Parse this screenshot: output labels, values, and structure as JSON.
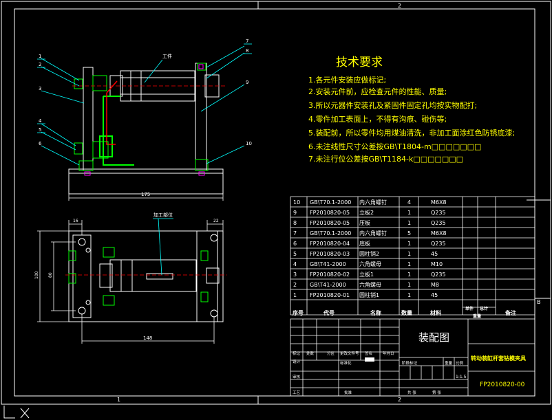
{
  "colors": {
    "background": "#000000",
    "outline": "#ffffff",
    "leader": "#00ffff",
    "text_yellow": "#ffff00",
    "part_green": "#00ff00",
    "part_red": "#ff0000",
    "marker_magenta": "#ff00ff"
  },
  "sheet": {
    "zone_top": "2",
    "zone_bottom_left": "1",
    "zone_bottom_right": "2",
    "zone_right": "B"
  },
  "front_view": {
    "balloons": [
      "1",
      "2",
      "3",
      "4",
      "5",
      "6",
      "7",
      "8",
      "9",
      "10"
    ],
    "workpiece_label": "工件",
    "dim_width": "175"
  },
  "top_view": {
    "dim_left": "16",
    "dim_right": "22",
    "dim_height_outer": "100",
    "dim_height_inner": "80",
    "dim_width": "148",
    "machining_label": "加工部位"
  },
  "tech_requirements": {
    "title": "技术要求",
    "items": [
      "1.各元件安装应做标记;",
      "2.安装元件前，应检查元件的性能、质量;",
      "3.所以元器件安装孔及紧固件固定孔均按实物配打;",
      "4.零件加工表面上，不得有沟痕、碰伤等;",
      "5.装配前，所以零件均用煤油清洗，非加工面涂红色防锈底漆;",
      "6.未注线性尺寸公差按GB\\T1804-m□□□□□□□",
      "7.未注行位公差按GB\\T1184-k□□□□□□□"
    ]
  },
  "bom": {
    "headers": [
      "序号",
      "代号",
      "名称",
      "数量",
      "材料",
      "单件",
      "总计",
      "备注"
    ],
    "weight_label": "重量",
    "rows": [
      [
        "10",
        "GB\\T70.1-2000",
        "内六角螺钉",
        "4",
        "M6X8"
      ],
      [
        "9",
        "FP2010820-05",
        "立板2",
        "1",
        "Q235"
      ],
      [
        "8",
        "FP2010820-05",
        "压板",
        "1",
        "Q235"
      ],
      [
        "7",
        "GB\\T70.1-2000",
        "内六角螺钉",
        "5",
        "M6X8"
      ],
      [
        "6",
        "FP2010820-04",
        "底板",
        "1",
        "Q235"
      ],
      [
        "5",
        "FP2010820-03",
        "圆柱销2",
        "1",
        "45"
      ],
      [
        "4",
        "GB\\T41-2000",
        "六角螺母",
        "1",
        "M10"
      ],
      [
        "3",
        "FP2010820-02",
        "立板1",
        "1",
        "Q235"
      ],
      [
        "2",
        "GB\\T41-2000",
        "六角螺母",
        "1",
        "M8"
      ],
      [
        "1",
        "FP2010820-01",
        "圆柱销1",
        "1",
        "45"
      ]
    ]
  },
  "title_block": {
    "drawing_type": "装配图",
    "part_name": "转动装缸杆套钻模夹具",
    "drawing_number": "FP2010820-00",
    "scale": "1:1.5",
    "labels": {
      "mark": "标记",
      "count": "处数",
      "zone": "分区",
      "change_doc": "更改文件号",
      "sign": "签名",
      "date": "年月日",
      "design": "设计",
      "standard": "标准化",
      "stage_mark": "阶段标记",
      "weight": "重量",
      "ratio": "比例",
      "review": "审核",
      "process": "工艺",
      "approve": "批准",
      "sheets_total": "共 张",
      "sheet_no": "第 张"
    }
  }
}
